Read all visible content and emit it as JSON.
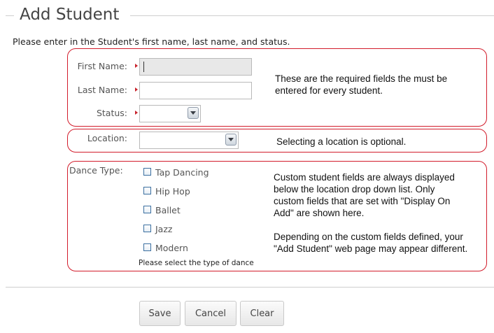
{
  "header": {
    "title": "Add Student"
  },
  "instructions": "Please enter in the Student's first name, last name, and status.",
  "fields": {
    "first_name": {
      "label": "First Name:",
      "value": ""
    },
    "last_name": {
      "label": "Last Name:",
      "value": ""
    },
    "status": {
      "label": "Status:",
      "value": ""
    },
    "location": {
      "label": "Location:",
      "value": ""
    }
  },
  "dance_type": {
    "label": "Dance Type:",
    "options": [
      "Tap Dancing",
      "Hip Hop",
      "Ballet",
      "Jazz",
      "Modern"
    ],
    "hint": "Please select the type of dance"
  },
  "notes": {
    "required_line1": "These are the required fields the must be",
    "required_line2": "entered for every student.",
    "location": "Selecting a location is optional.",
    "custom_line1": "Custom student fields are always displayed",
    "custom_line2": "below the location drop down list.  Only",
    "custom_line3": "custom fields that are set with \"Display On",
    "custom_line4": "Add\" are shown here.",
    "custom_line5": "Depending on the custom fields defined, your",
    "custom_line6": "\"Add Student\" web page may appear different."
  },
  "buttons": {
    "save": "Save",
    "cancel": "Cancel",
    "clear": "Clear"
  },
  "colors": {
    "annotation": "#d21c2b",
    "required_marker": "#c8232c"
  }
}
